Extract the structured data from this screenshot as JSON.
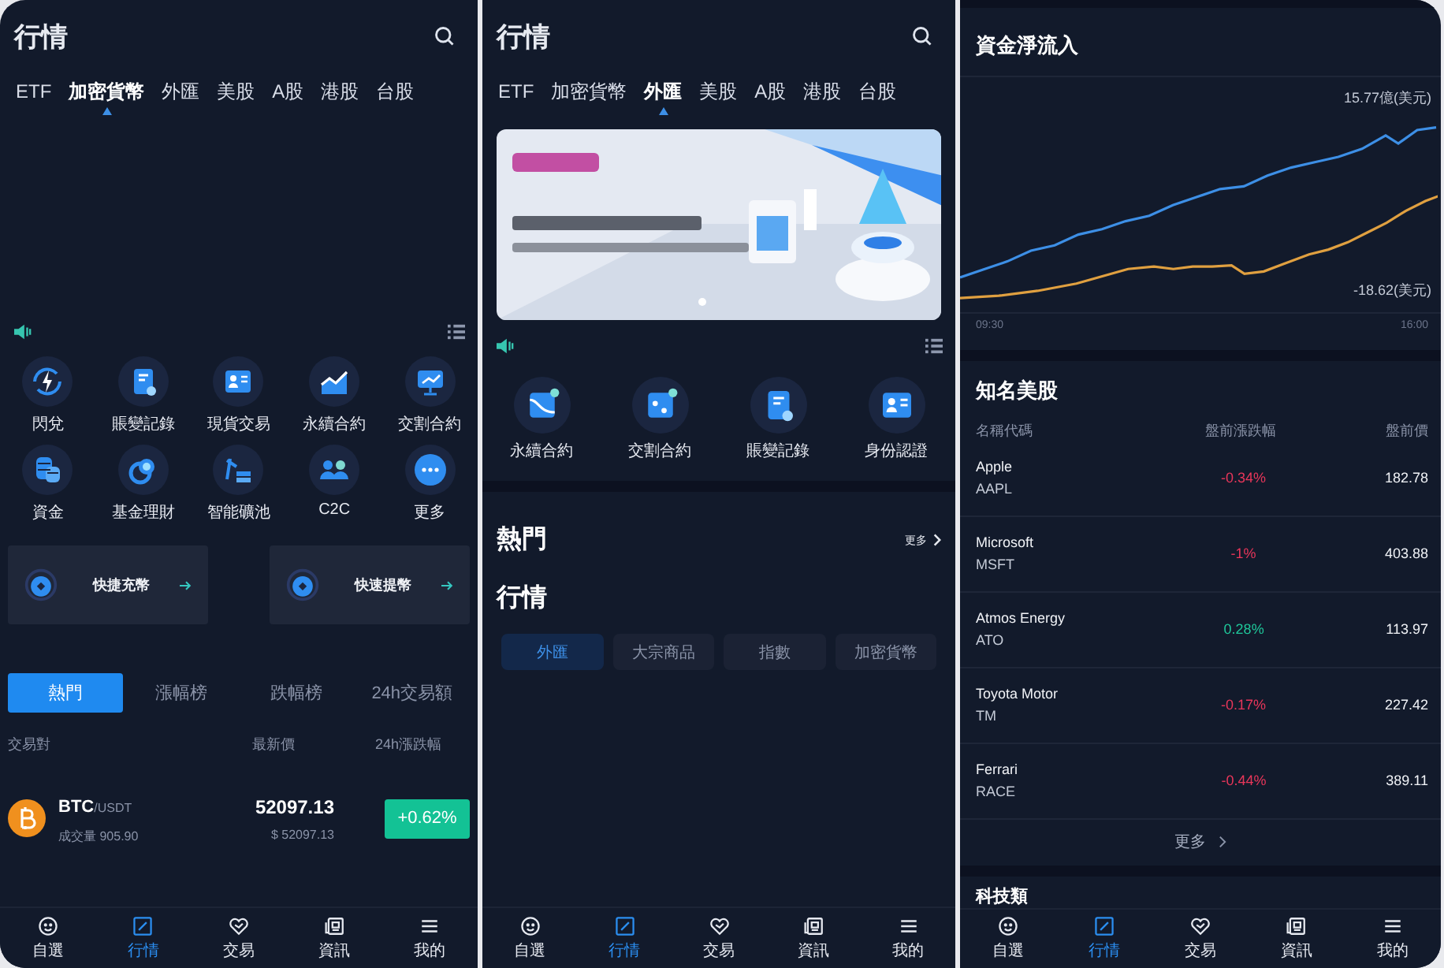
{
  "left": {
    "title": "行情",
    "tabs": [
      {
        "label": "ETF",
        "selected": false
      },
      {
        "label": "加密貨幣",
        "selected": true
      },
      {
        "label": "外匯",
        "selected": false
      },
      {
        "label": "美股",
        "selected": false
      },
      {
        "label": "A股",
        "selected": false
      },
      {
        "label": "港股",
        "selected": false
      },
      {
        "label": "台股",
        "selected": false
      }
    ],
    "shortcuts": [
      "閃兌",
      "賬變記錄",
      "現貨交易",
      "永續合約",
      "交割合約",
      "資金",
      "基金理財",
      "智能礦池",
      "C2C",
      "更多"
    ],
    "promos": [
      "快捷充幣",
      "快速提幣"
    ],
    "rank_tabs": [
      {
        "label": "熱門",
        "selected": true
      },
      {
        "label": "漲幅榜",
        "selected": false
      },
      {
        "label": "跌幅榜",
        "selected": false
      },
      {
        "label": "24h交易額",
        "selected": false
      }
    ],
    "columns": [
      "交易對",
      "最新價",
      "24h漲跌幅"
    ],
    "rows": [
      {
        "base": "BTC",
        "quote": "/USDT",
        "volume": "成交量 905.90",
        "price": "52097.13",
        "price_usd": "$ 52097.13",
        "change": "+0.62%",
        "color": "#13c295"
      }
    ],
    "nav": [
      {
        "label": "自選",
        "selected": false
      },
      {
        "label": "行情",
        "selected": true
      },
      {
        "label": "交易",
        "selected": false
      },
      {
        "label": "資訊",
        "selected": false
      },
      {
        "label": "我的",
        "selected": false
      }
    ]
  },
  "middle": {
    "title": "行情",
    "tabs": [
      {
        "label": "ETF",
        "selected": false
      },
      {
        "label": "加密貨幣",
        "selected": false
      },
      {
        "label": "外匯",
        "selected": true
      },
      {
        "label": "美股",
        "selected": false
      },
      {
        "label": "A股",
        "selected": false
      },
      {
        "label": "港股",
        "selected": false
      },
      {
        "label": "台股",
        "selected": false
      }
    ],
    "banner": {
      "kind": "picture"
    },
    "shortcuts": [
      "永續合約",
      "交割合約",
      "賬變記錄",
      "身份認證"
    ],
    "hot_title": "熱門",
    "more": "更多",
    "market_title": "行情",
    "chips": [
      {
        "label": "外匯",
        "selected": true
      },
      {
        "label": "大宗商品",
        "selected": false
      },
      {
        "label": "指數",
        "selected": false
      },
      {
        "label": "加密貨幣",
        "selected": false
      }
    ],
    "nav": [
      {
        "label": "自選",
        "selected": false
      },
      {
        "label": "行情",
        "selected": true
      },
      {
        "label": "交易",
        "selected": false
      },
      {
        "label": "資訊",
        "selected": false
      },
      {
        "label": "我的",
        "selected": false
      }
    ]
  },
  "right": {
    "chart_title": "資金淨流入",
    "chart_max": "15.77億(美元)",
    "chart_min": "-18.62(美元)",
    "time_start": "09:30",
    "time_end": "16:00",
    "stocks_title": "知名美股",
    "columns": [
      "名稱代碼",
      "盤前漲跌幅",
      "盤前價"
    ],
    "stocks": [
      {
        "name": "Apple",
        "ticker": "AAPL",
        "change": "-0.34%",
        "price": "182.78",
        "color": "#e8365a"
      },
      {
        "name": "Microsoft",
        "ticker": "MSFT",
        "change": "-1%",
        "price": "403.88",
        "color": "#e8365a"
      },
      {
        "name": "Atmos Energy",
        "ticker": "ATO",
        "change": "0.28%",
        "price": "113.97",
        "color": "#1fc79a"
      },
      {
        "name": "Toyota Motor",
        "ticker": "TM",
        "change": "-0.17%",
        "price": "227.42",
        "color": "#e8365a"
      },
      {
        "name": "Ferrari",
        "ticker": "RACE",
        "change": "-0.44%",
        "price": "389.11",
        "color": "#e8365a"
      }
    ],
    "more": "更多",
    "next_title": "科技類",
    "nav": [
      {
        "label": "自選",
        "selected": false
      },
      {
        "label": "行情",
        "selected": true
      },
      {
        "label": "交易",
        "selected": false
      },
      {
        "label": "資訊",
        "selected": false
      },
      {
        "label": "我的",
        "selected": false
      }
    ]
  }
}
